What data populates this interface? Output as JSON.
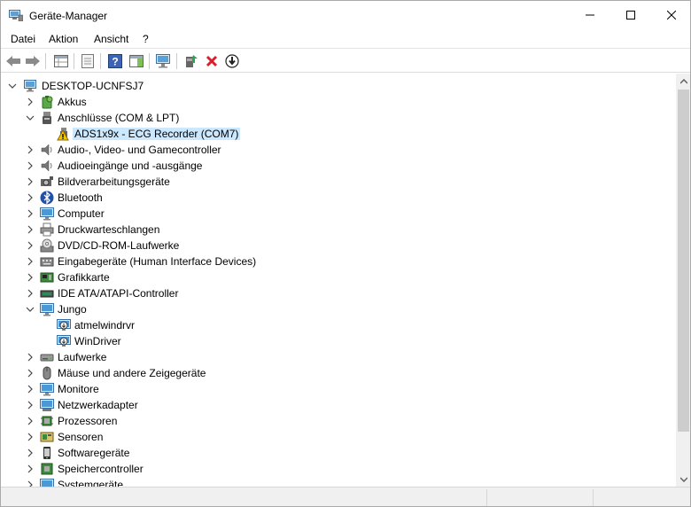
{
  "window": {
    "title": "Geräte-Manager",
    "controls": {
      "minimize": "—",
      "maximize": "☐",
      "close": "✕"
    }
  },
  "menu": [
    "Datei",
    "Aktion",
    "Ansicht",
    "?"
  ],
  "toolbar": [
    "back-icon",
    "forward-icon",
    "properties-grid-icon",
    "properties-sheet-icon",
    "help-icon",
    "action-pane-icon",
    "scan-hardware-icon",
    "update-driver-icon",
    "uninstall-device-icon",
    "download-driver-icon"
  ],
  "tree": {
    "root": "DESKTOP-UCNFSJ7",
    "items": [
      {
        "label": "Akkus",
        "icon": "battery-icon",
        "state": "collapsed"
      },
      {
        "label": "Anschlüsse (COM & LPT)",
        "icon": "port-icon",
        "state": "expanded"
      },
      {
        "label": "ADS1x9x - ECG Recorder (COM7)",
        "icon": "warning-device-icon",
        "child": true,
        "selected": true
      },
      {
        "label": "Audio-, Video- und Gamecontroller",
        "icon": "speaker-icon",
        "state": "collapsed"
      },
      {
        "label": "Audioeingänge und -ausgänge",
        "icon": "speaker-icon",
        "state": "collapsed"
      },
      {
        "label": "Bildverarbeitungsgeräte",
        "icon": "camera-icon",
        "state": "collapsed"
      },
      {
        "label": "Bluetooth",
        "icon": "bluetooth-icon",
        "state": "collapsed"
      },
      {
        "label": "Computer",
        "icon": "monitor-icon",
        "state": "collapsed"
      },
      {
        "label": "Druckwarteschlangen",
        "icon": "printer-icon",
        "state": "collapsed"
      },
      {
        "label": "DVD/CD-ROM-Laufwerke",
        "icon": "disc-icon",
        "state": "collapsed"
      },
      {
        "label": "Eingabegeräte (Human Interface Devices)",
        "icon": "hid-icon",
        "state": "collapsed"
      },
      {
        "label": "Grafikkarte",
        "icon": "display-adapter-icon",
        "state": "collapsed"
      },
      {
        "label": "IDE ATA/ATAPI-Controller",
        "icon": "ide-controller-icon",
        "state": "collapsed"
      },
      {
        "label": "Jungo",
        "icon": "monitor-icon",
        "state": "expanded"
      },
      {
        "label": "atmelwindrvr",
        "icon": "driver-icon",
        "child": true
      },
      {
        "label": "WinDriver",
        "icon": "driver-icon",
        "child": true
      },
      {
        "label": "Laufwerke",
        "icon": "disk-drive-icon",
        "state": "collapsed"
      },
      {
        "label": "Mäuse und andere Zeigegeräte",
        "icon": "mouse-icon",
        "state": "collapsed"
      },
      {
        "label": "Monitore",
        "icon": "monitor-icon",
        "state": "collapsed"
      },
      {
        "label": "Netzwerkadapter",
        "icon": "network-adapter-icon",
        "state": "collapsed"
      },
      {
        "label": "Prozessoren",
        "icon": "cpu-icon",
        "state": "collapsed"
      },
      {
        "label": "Sensoren",
        "icon": "sensor-icon",
        "state": "collapsed"
      },
      {
        "label": "Softwaregeräte",
        "icon": "software-device-icon",
        "state": "collapsed"
      },
      {
        "label": "Speichercontroller",
        "icon": "storage-controller-icon",
        "state": "collapsed"
      },
      {
        "label": "Systemgeräte",
        "icon": "system-device-icon",
        "state": "collapsed"
      }
    ]
  },
  "colors": {
    "selection": "#cce8ff",
    "accent": "#0078d7",
    "error_red": "#e81123",
    "warning_yellow": "#f6c700"
  }
}
